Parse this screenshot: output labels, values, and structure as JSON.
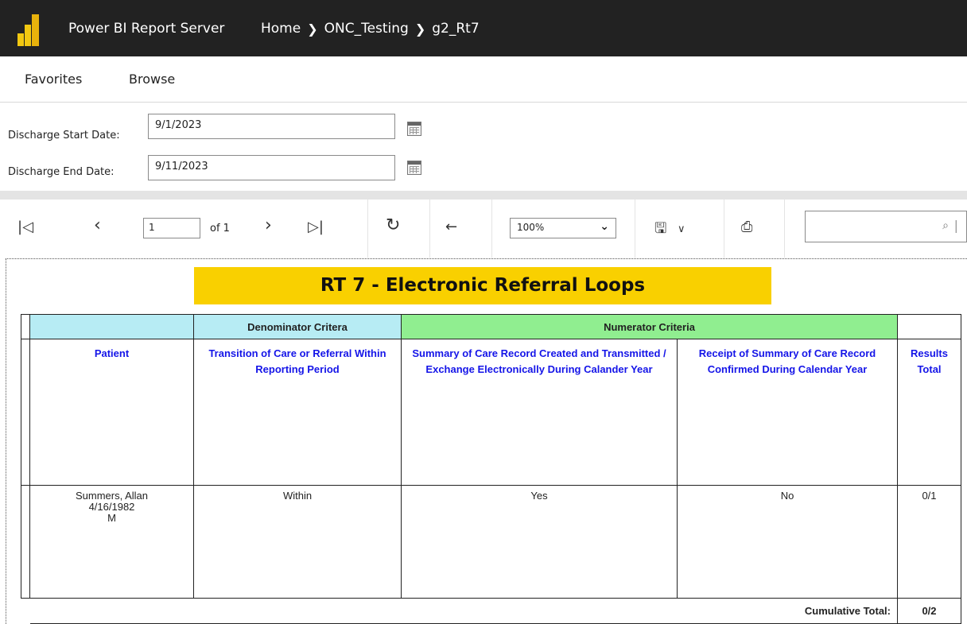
{
  "app": {
    "brand": "Power BI Report Server",
    "breadcrumbs": [
      "Home",
      "ONC_Testing",
      "g2_Rt7"
    ]
  },
  "nav": {
    "favorites": "Favorites",
    "browse": "Browse"
  },
  "params": {
    "start_label": "Discharge Start Date:",
    "start_value": "9/1/2023",
    "end_label": "Discharge End Date:",
    "end_value": "9/11/2023"
  },
  "toolbar": {
    "page_value": "1",
    "of_label": "of 1",
    "zoom": "100%"
  },
  "report": {
    "title": "RT 7 - Electronic Referral Loops",
    "group_headers": {
      "denominator": "Denominator Critera",
      "numerator": "Numerator Criteria"
    },
    "columns": {
      "patient": "Patient",
      "transition": "Transition of Care or Referral Within Reporting Period",
      "summary": "Summary of Care Record Created and Transmitted / Exchange Electronically During Calander Year",
      "receipt": "Receipt of Summary of Care Record Confirmed During Calendar Year",
      "results": "Results Total"
    },
    "rows": [
      {
        "patient_name": "Summers, Allan",
        "patient_dob": "4/16/1982",
        "patient_sex": "M",
        "transition": "Within",
        "summary": "Yes",
        "receipt": "No",
        "results": "0/1"
      }
    ],
    "cumulative_label": "Cumulative Total:",
    "cumulative_value": "0/2"
  },
  "icons": {
    "first_page": "first-page-icon",
    "prev_page": "previous-page-icon",
    "next_page": "next-page-icon",
    "last_page": "last-page-icon",
    "refresh": "refresh-icon",
    "back": "back-icon",
    "save": "save-icon",
    "print": "print-icon",
    "search": "search-icon",
    "calendar": "calendar-icon"
  },
  "colors": {
    "topbar": "#222222",
    "title_bg": "#f9d000",
    "denominator_bg": "#b7ecf4",
    "numerator_bg": "#90ee90",
    "header_text": "#1515e8"
  }
}
